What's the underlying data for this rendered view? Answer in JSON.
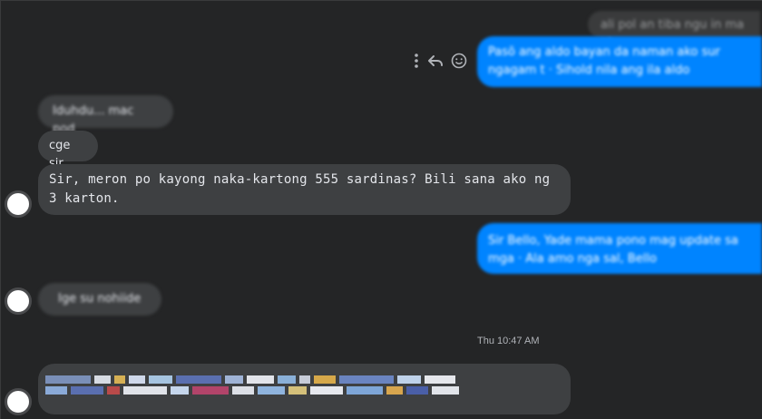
{
  "messages": {
    "top_ghost": "ali pol an tiba ngu in ma at",
    "out_1": "Pasō ang aldo bayan da naman ako sur ngagam t · Sihold nila ang ila aldo",
    "in_1": "Iduhdu... mac pod",
    "in_2": "cge sir",
    "in_3": "Sir, meron po kayong naka-kartong 555 sardinas? Bili sana ako ng 3 karton.",
    "out_2": "Sir Bello, Yade mama pono mag update sa mga · Ala amo nga sal, Bello",
    "in_4": "Ige su nohiide",
    "timestamp": "Thu 10:47 AM"
  },
  "colors": {
    "background": "#242526",
    "incoming": "#3e4042",
    "outgoing": "#0084ff"
  },
  "icons": {
    "more": "vertical-dots-icon",
    "reply": "reply-arrow-icon",
    "react": "smiley-icon"
  }
}
